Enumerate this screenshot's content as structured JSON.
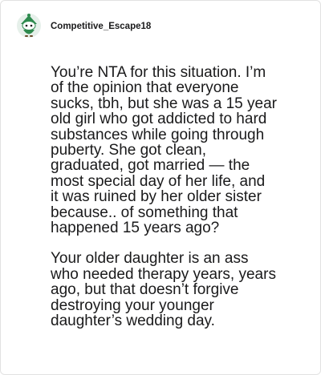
{
  "comment": {
    "author": {
      "username": "Competitive_Escape18",
      "avatar_icon": "snoo-avatar-icon"
    },
    "paragraphs": [
      "You’re NTA for this situation. I’m\nof the opinion that everyone\nsucks, tbh, but she was a 15 year\nold girl who got addicted to hard\nsubstances while going through\npuberty. She got clean,\ngraduated, got married — the\nmost special day of her life, and\nit was ruined by her older sister\nbecause.. of something that\nhappened 15 years ago?",
      "Your older daughter is an ass\nwho needed therapy years, years\nago, but that doesn’t forgive\ndestroying your younger\ndaughter’s wedding day."
    ]
  },
  "colors": {
    "text": "#1a1a1b",
    "avatar_green": "#2e8a4e",
    "avatar_bg": "#e6f0ea",
    "border": "#e2e2e2"
  }
}
